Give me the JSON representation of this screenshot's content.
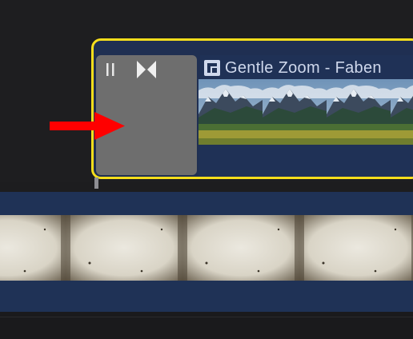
{
  "connected_clip": {
    "title": "Gentle Zoom - Faben",
    "selection_color": "#f7de1c",
    "clip_color": "#1f3156",
    "type_icon": "connected-clip-icon"
  },
  "transition": {
    "icons": [
      "pause-icon",
      "bowtie-transition-icon"
    ],
    "background": "#6e6e6e"
  },
  "annotation": {
    "icon": "red-arrow-icon",
    "color": "#ff0000"
  },
  "primary_clip": {
    "thumbnail": "textured-paper",
    "clip_color": "#1f3256"
  }
}
